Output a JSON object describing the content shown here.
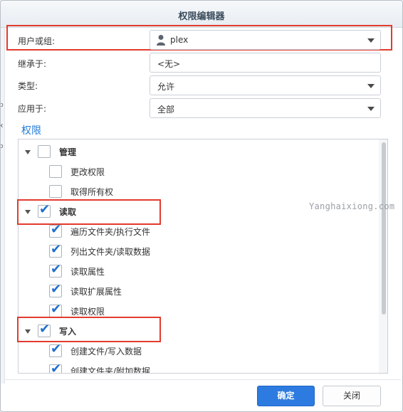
{
  "window": {
    "title": "权限编辑器"
  },
  "left_edge_chars": [
    "b",
    "x",
    "o"
  ],
  "form": {
    "user_label": "用户或组:",
    "user_value": "plex",
    "inherit_label": "继承于:",
    "inherit_value": "<无>",
    "type_label": "类型:",
    "type_value": "允许",
    "apply_label": "应用于:",
    "apply_value": "全部"
  },
  "permissions": {
    "title": "权限",
    "groups": [
      {
        "label": "管理",
        "checked": false,
        "items": [
          {
            "label": "更改权限",
            "checked": false
          },
          {
            "label": "取得所有权",
            "checked": false
          }
        ]
      },
      {
        "label": "读取",
        "checked": true,
        "items": [
          {
            "label": "遍历文件夹/执行文件",
            "checked": true
          },
          {
            "label": "列出文件夹/读取数据",
            "checked": true
          },
          {
            "label": "读取属性",
            "checked": true
          },
          {
            "label": "读取扩展属性",
            "checked": true
          },
          {
            "label": "读取权限",
            "checked": true
          }
        ]
      },
      {
        "label": "写入",
        "checked": true,
        "items": [
          {
            "label": "创建文件/写入数据",
            "checked": true
          },
          {
            "label": "创建文件夹/附加数据",
            "checked": true
          }
        ]
      }
    ]
  },
  "watermark": "Yanghaixiong.com",
  "buttons": {
    "ok": "确定",
    "close": "关闭"
  },
  "colors": {
    "accent": "#2d7be0",
    "highlight": "#e23b2e",
    "check": "#1f6fcf"
  }
}
